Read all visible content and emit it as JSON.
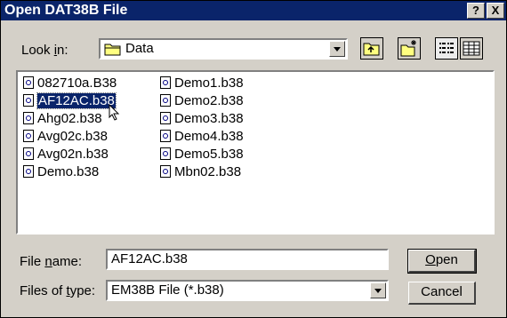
{
  "window": {
    "title": "Open DAT38B File",
    "help_label": "?",
    "close_label": "X"
  },
  "look_in": {
    "label_pre": "Look ",
    "label_accel": "i",
    "label_post": "n:",
    "value": "Data"
  },
  "files": {
    "column1": [
      "082710a.B38",
      "AF12AC.b38",
      "Ahg02.b38",
      "Avg02c.b38",
      "Avg02n.b38",
      "Demo.b38"
    ],
    "column2": [
      "Demo1.b38",
      "Demo2.b38",
      "Demo3.b38",
      "Demo4.b38",
      "Demo5.b38",
      "Mbn02.b38"
    ],
    "selected": "AF12AC.b38"
  },
  "file_name": {
    "label_pre": "File ",
    "label_accel": "n",
    "label_post": "ame:",
    "value": "AF12AC.b38"
  },
  "file_type": {
    "label_pre": "Files of ",
    "label_accel": "t",
    "label_post": "ype:",
    "value": "EM38B File (*.b38)"
  },
  "buttons": {
    "open_accel": "O",
    "open_rest": "pen",
    "cancel": "Cancel"
  },
  "colors": {
    "titlebar": "#0a246a",
    "face": "#d4d0c8",
    "selection": "#0a246a"
  }
}
